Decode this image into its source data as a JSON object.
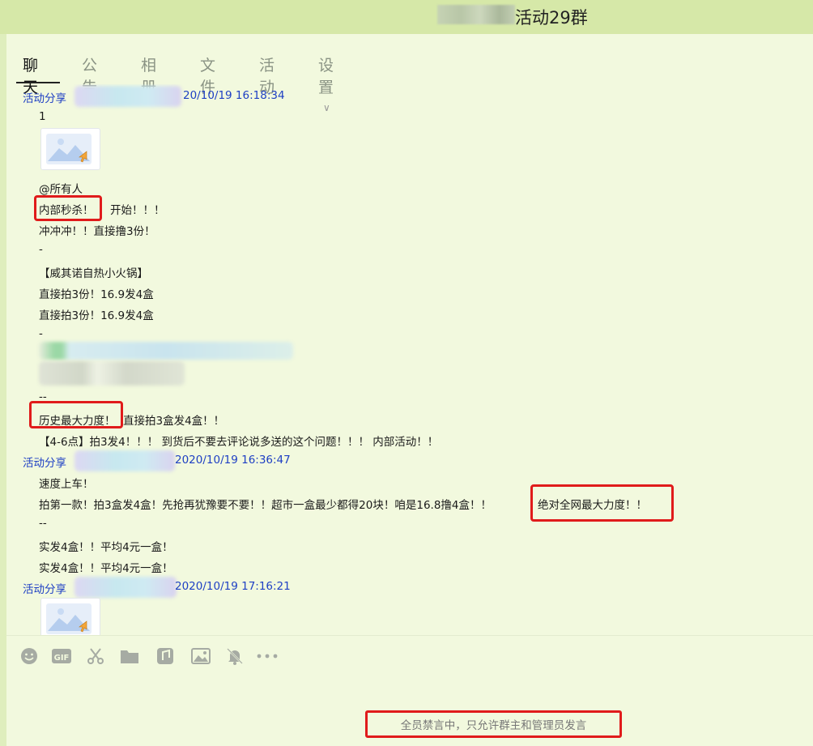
{
  "window": {
    "title": "活动29群"
  },
  "tabs": [
    {
      "label": "聊天",
      "active": true
    },
    {
      "label": "公告"
    },
    {
      "label": "相册"
    },
    {
      "label": "文件"
    },
    {
      "label": "活动"
    },
    {
      "label": "设置"
    }
  ],
  "messages": [
    {
      "sender_prefix": "活动分享",
      "timestamp": "20/10/19 16:18:34",
      "lines": [
        "1",
        "@所有人",
        "内部秒杀！",
        "开始！！！",
        "冲冲冲！！直接撸3份！",
        "-",
        "【威其诺自热小火锅】",
        "直接拍3份！16.9发4盒",
        "直接拍3份！16.9发4盒",
        "-",
        "--",
        "历史最大力度！",
        "直接拍3盒发4盒！！",
        "【4-6点】拍3发4！！！ 到货后不要去评论说多送的这个问题！！！ 内部活动！！"
      ]
    },
    {
      "sender_prefix": "活动分享",
      "timestamp": "2020/10/19 16:36:47",
      "lines": [
        "速度上车！",
        "拍第一款！拍3盒发4盒！先抢再犹豫要不要！！超市一盒最少都得20块！咱是16.8撸4盒！！",
        "绝对全网最大力度！！",
        "--",
        "实发4盒！！平均4元一盒！",
        "实发4盒！！平均4元一盒！"
      ]
    },
    {
      "sender_prefix": "活动分享",
      "timestamp": "2020/10/19 17:16:21",
      "lines": []
    }
  ],
  "toolbar": [
    "emoji-icon",
    "gif-icon",
    "scissors-icon",
    "folder-icon",
    "music-icon",
    "image-icon",
    "bell-mute-icon",
    "more-icon"
  ],
  "mute_notice": "全员禁言中，只允许群主和管理员发言",
  "colors": {
    "sender": "#1f40c4",
    "highlight": "#e01b1b",
    "background": "#f2f9de"
  }
}
